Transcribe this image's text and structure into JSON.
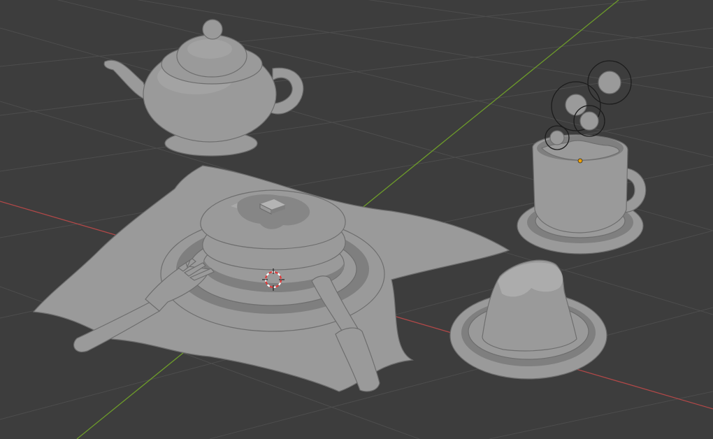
{
  "viewport": {
    "background_color": "#3d3d3d",
    "grid_color": "#4d4d4d",
    "x_axis_color": "#b04848",
    "y_axis_color": "#6d9b2a",
    "model_color": "#9a9a9a",
    "origin_color": "#f0a000",
    "cursor_colors": [
      "#e03a3a",
      "#ffffff"
    ]
  },
  "objects": [
    "teapot",
    "napkin",
    "plate",
    "pancake-stack",
    "butter",
    "fork",
    "knife",
    "mug",
    "saucer",
    "pudding",
    "pudding-plate",
    "steam-spheres"
  ]
}
